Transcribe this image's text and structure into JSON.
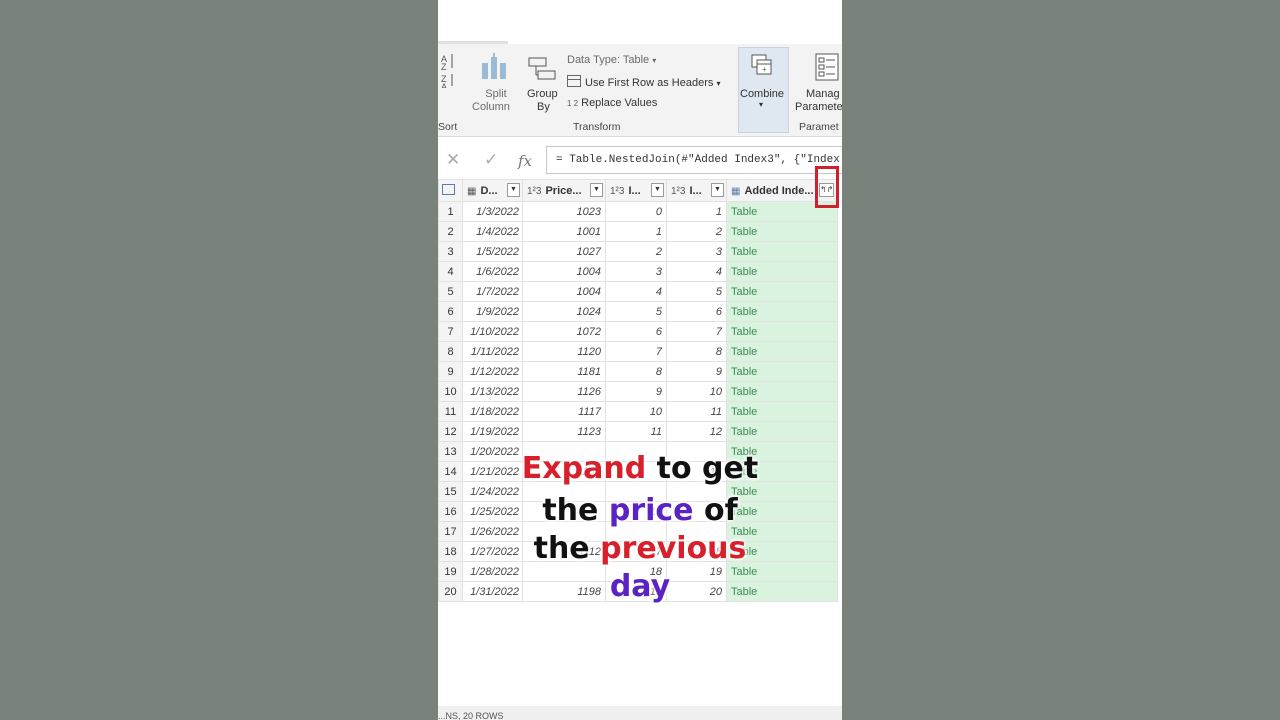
{
  "ribbon": {
    "sort_label": "Sort",
    "split_column": [
      "Split",
      "Column"
    ],
    "group_by": [
      "Group",
      "By"
    ],
    "data_type": "Data Type: Table",
    "use_first_row": "Use First Row as Headers",
    "replace_values": "Replace Values",
    "transform_label": "Transform",
    "combine": "Combine",
    "manage_params": [
      "Manag",
      "Paramete"
    ],
    "params_label": "Paramet",
    "replace_icon_text": "1 2"
  },
  "formula_bar": {
    "formula": "= Table.NestedJoin(#\"Added Index3\", {\"Index"
  },
  "columns": [
    {
      "type": "",
      "name": ""
    },
    {
      "type": "cal",
      "name": "D..."
    },
    {
      "type": "123",
      "name": "Price..."
    },
    {
      "type": "123",
      "name": "I..."
    },
    {
      "type": "123",
      "name": "I..."
    },
    {
      "type": "tbl",
      "name": "Added Inde..."
    }
  ],
  "rows": [
    [
      "1",
      "1/3/2022",
      "1023",
      "0",
      "1",
      "Table"
    ],
    [
      "2",
      "1/4/2022",
      "1001",
      "1",
      "2",
      "Table"
    ],
    [
      "3",
      "1/5/2022",
      "1027",
      "2",
      "3",
      "Table"
    ],
    [
      "4",
      "1/6/2022",
      "1004",
      "3",
      "4",
      "Table"
    ],
    [
      "5",
      "1/7/2022",
      "1004",
      "4",
      "5",
      "Table"
    ],
    [
      "6",
      "1/9/2022",
      "1024",
      "5",
      "6",
      "Table"
    ],
    [
      "7",
      "1/10/2022",
      "1072",
      "6",
      "7",
      "Table"
    ],
    [
      "8",
      "1/11/2022",
      "1120",
      "7",
      "8",
      "Table"
    ],
    [
      "9",
      "1/12/2022",
      "1181",
      "8",
      "9",
      "Table"
    ],
    [
      "10",
      "1/13/2022",
      "1126",
      "9",
      "10",
      "Table"
    ],
    [
      "11",
      "1/18/2022",
      "1117",
      "10",
      "11",
      "Table"
    ],
    [
      "12",
      "1/19/2022",
      "1123",
      "11",
      "12",
      "Table"
    ],
    [
      "13",
      "1/20/2022",
      "",
      "",
      "",
      "Table"
    ],
    [
      "14",
      "1/21/2022",
      "1189",
      "",
      "14",
      "Table"
    ],
    [
      "15",
      "1/24/2022",
      "",
      "",
      "",
      "Table"
    ],
    [
      "16",
      "1/25/2022",
      "",
      "15",
      "",
      "Table"
    ],
    [
      "17",
      "1/26/2022",
      "",
      "",
      "",
      "Table"
    ],
    [
      "18",
      "1/27/2022",
      "1112",
      "17",
      "18",
      "Table"
    ],
    [
      "19",
      "1/28/2022",
      "",
      "18",
      "19",
      "Table"
    ],
    [
      "20",
      "1/31/2022",
      "1198",
      "19",
      "20",
      "Table"
    ]
  ],
  "status_bar": "...NS, 20 ROWS",
  "caption": {
    "w1": "Expand",
    "w2": " to get",
    "w3": "the ",
    "w4": "price",
    "w5": " of",
    "w6": "the ",
    "w7": "previous",
    "w8": "day"
  },
  "colors": {
    "accent_red": "#d8202c",
    "accent_purple": "#5b23c4",
    "table_cell_green": "#d9f3df"
  }
}
